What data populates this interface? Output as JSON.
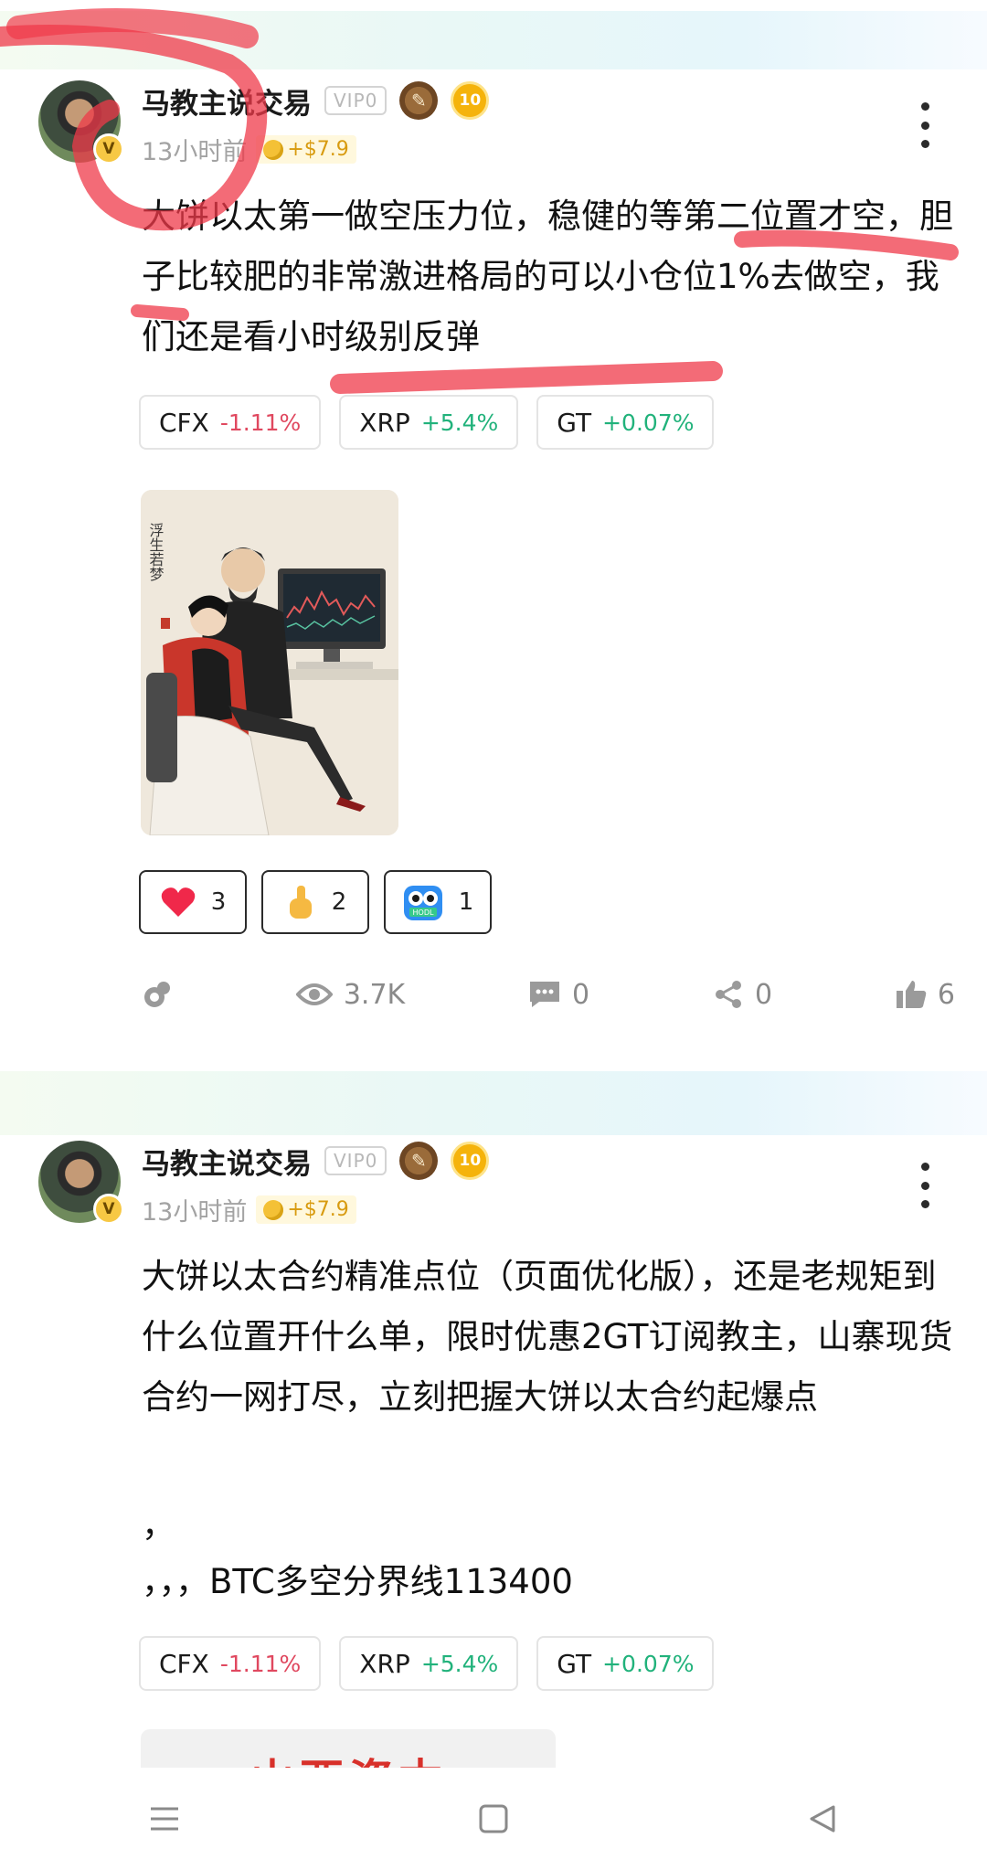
{
  "posts": [
    {
      "author": "马教主说交易",
      "vip": "VIP0",
      "level": "10",
      "avatar_badge": "V",
      "time": "13小时前",
      "profit": "+$7.9",
      "text": "大饼以太第一做空压力位，稳健的等第二位置才空，胆子比较肥的非常激进格局的可以小仓位1%去做空，我们还是看小时级别反弹",
      "tags": [
        {
          "symbol": "CFX",
          "change": "-1.11%",
          "direction": "neg"
        },
        {
          "symbol": "XRP",
          "change": "+5.4%",
          "direction": "pos"
        },
        {
          "symbol": "GT",
          "change": "+0.07%",
          "direction": "pos"
        }
      ],
      "image_text": "浮生若梦",
      "reactions": [
        {
          "icon": "heart-icon",
          "count": "3"
        },
        {
          "icon": "thumbs-up-emoji-icon",
          "count": "2"
        },
        {
          "icon": "hodl-owl-icon",
          "count": "1",
          "label": "HODL"
        }
      ],
      "stats": {
        "views": "3.7K",
        "comments": "0",
        "shares": "0",
        "likes": "6"
      }
    },
    {
      "author": "马教主说交易",
      "vip": "VIP0",
      "level": "10",
      "avatar_badge": "V",
      "time": "13小时前",
      "profit": "+$7.9",
      "text_lines": [
        "大饼以太合约精准点位（页面优化版），还是老规矩到什么位置开什么单，限时优惠2GT订阅教主，山寨现货合约一网打尽，立刻把握大饼以太合约起爆点",
        "，",
        "，，，BTC多空分界线113400"
      ],
      "tags": [
        {
          "symbol": "CFX",
          "change": "-1.11%",
          "direction": "neg"
        },
        {
          "symbol": "XRP",
          "change": "+5.4%",
          "direction": "pos"
        },
        {
          "symbol": "GT",
          "change": "+0.07%",
          "direction": "pos"
        }
      ],
      "image_text": "山西资本"
    }
  ],
  "colors": {
    "negative": "#e0485f",
    "positive": "#21b27b",
    "highlight": "#ef3a4a",
    "badge_gold": "#f5b30b"
  }
}
